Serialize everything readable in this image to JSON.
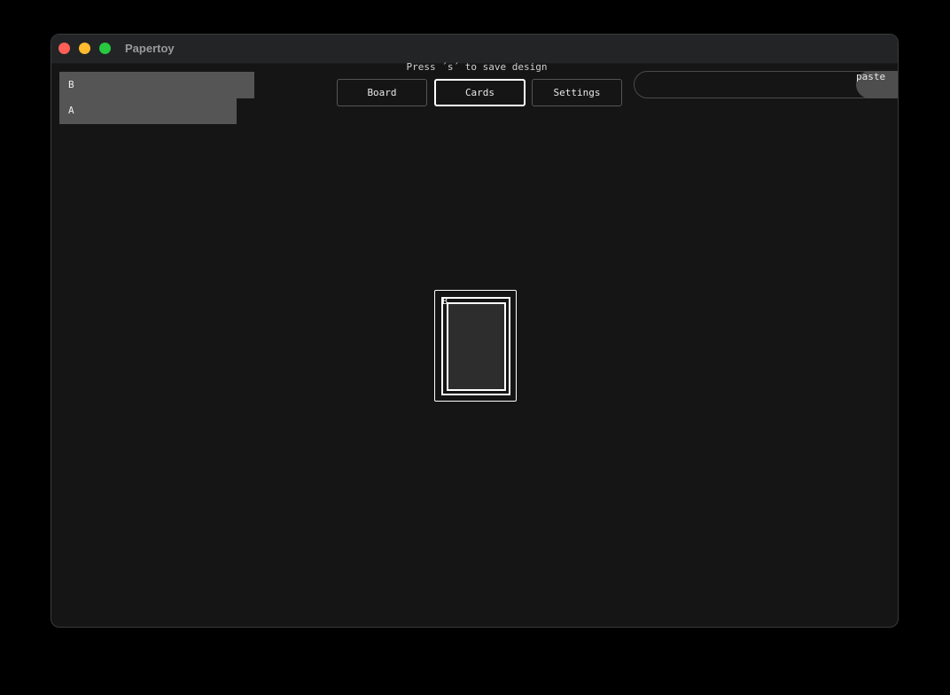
{
  "window": {
    "title": "Papertoy"
  },
  "sidebar": {
    "items": [
      {
        "label": "B"
      },
      {
        "label": "A"
      }
    ]
  },
  "header": {
    "hint": "Press ´s´ to save design",
    "tabs": [
      {
        "label": "Board",
        "selected": false
      },
      {
        "label": "Cards",
        "selected": true
      },
      {
        "label": "Settings",
        "selected": false
      }
    ]
  },
  "paste": {
    "value": "",
    "button_label": "paste"
  },
  "card": {
    "corner_label": "B"
  },
  "colors": {
    "window_bg": "#151515",
    "titlebar_bg": "#222426",
    "list_item_bg": "#555555",
    "accent_selected": "#ffffff",
    "card_fill": "#2d2d2d"
  }
}
